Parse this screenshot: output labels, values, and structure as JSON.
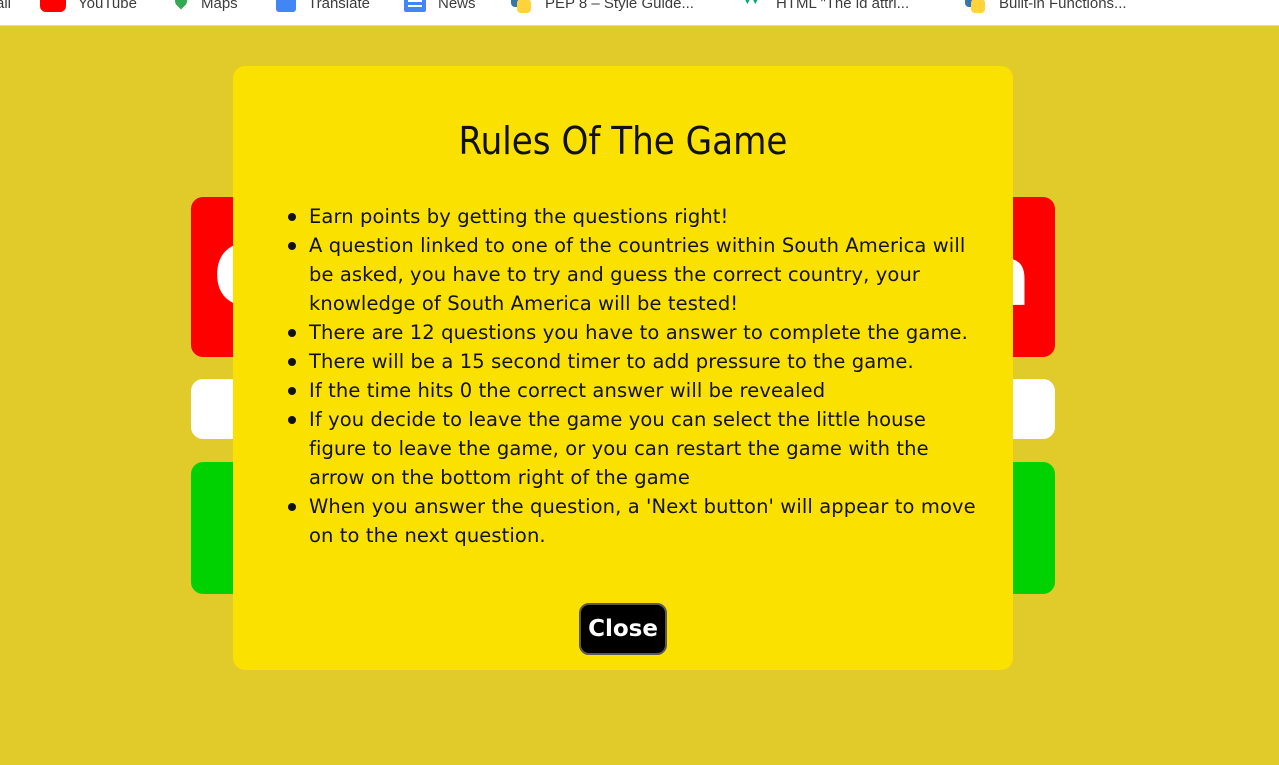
{
  "bookmarks": [
    {
      "label": "ail",
      "icon": "none"
    },
    {
      "label": "YouTube",
      "icon": "youtube-icon"
    },
    {
      "label": "Maps",
      "icon": "maps-icon"
    },
    {
      "label": "Translate",
      "icon": "translate-icon"
    },
    {
      "label": "News",
      "icon": "news-icon"
    },
    {
      "label": "PEP 8 – Style Guide...",
      "icon": "python-icon"
    },
    {
      "label": "HTML \"The id attri...",
      "icon": "w3schools-icon"
    },
    {
      "label": "Built-in Functions...",
      "icon": "python-icon"
    }
  ],
  "game": {
    "glyph_left": "Q",
    "glyph_right": "a"
  },
  "modal": {
    "title": "Rules Of The Game",
    "rules": [
      "Earn points by getting the questions right!",
      "A question linked to one of the countries within South America will be asked, you have to try and guess the correct country, your knowledge of South America will be tested!",
      "There are 12 questions you have to answer to complete the game.",
      "There will be a 15 second timer to add pressure to the game.",
      "If the time hits 0 the correct answer will be revealed",
      "If you decide to leave the game you can select the little house figure to leave the game, or you can restart the game with the arrow on the bottom right of the game",
      "When you answer the question, a 'Next button' will appear to move on to the next question."
    ],
    "close_label": "Close"
  },
  "colors": {
    "page_background": "#e0cb2b",
    "modal_background": "#fbe100",
    "question_panel": "#ff0000",
    "answer_panel": "#00d100",
    "close_button": "#000000"
  }
}
